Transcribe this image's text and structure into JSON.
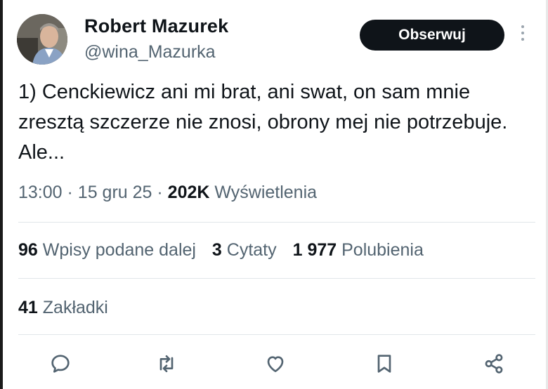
{
  "author": {
    "name": "Robert Mazurek",
    "handle": "@wina_Mazurka"
  },
  "follow_label": "Obserwuj",
  "tweet": {
    "text": "1) Cenckiewicz ani mi brat, ani swat, on sam mnie zresztą szczerze nie znosi, obrony mej nie potrzebuje. Ale...",
    "time": "13:00",
    "date": "15 gru 25",
    "views_count": "202K",
    "views_label": "Wyświetlenia"
  },
  "stats": {
    "reposts_count": "96",
    "reposts_label": "Wpisy podane dalej",
    "quotes_count": "3",
    "quotes_label": "Cytaty",
    "likes_count": "1 977",
    "likes_label": "Polubienia",
    "bookmarks_count": "41",
    "bookmarks_label": "Zakładki"
  },
  "icons": {
    "reply": "reply-icon",
    "repost": "repost-icon",
    "like": "heart-icon",
    "bookmark": "bookmark-icon",
    "share": "share-icon",
    "more": "more-vertical-icon"
  },
  "colors": {
    "text_primary": "#0f1419",
    "text_secondary": "#536471",
    "button_bg": "#0f1419",
    "divider": "#e1e6ea"
  }
}
